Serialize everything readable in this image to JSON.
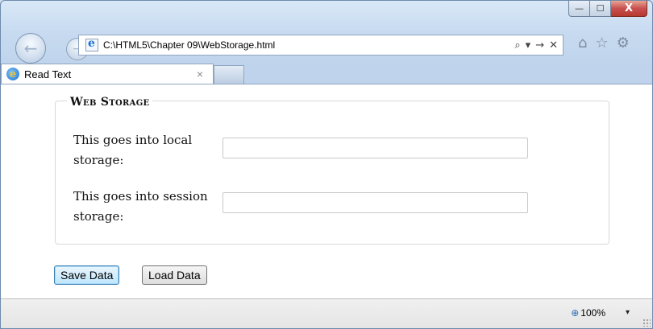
{
  "window": {
    "caption_buttons": {
      "minimize": "—",
      "maximize": "☐",
      "close": "X"
    }
  },
  "nav": {
    "back_glyph": "←",
    "forward_glyph": "→",
    "address": "C:\\HTML5\\Chapter 09\\WebStorage.html",
    "search_glyph": "⌕",
    "dropdown_glyph": "▾",
    "go_glyph": "→",
    "stop_glyph": "✕",
    "right_icons": {
      "home": "⌂",
      "favorites": "☆",
      "tools": "⚙"
    }
  },
  "tab": {
    "icon_letter": "e",
    "label": "Read Text",
    "close_glyph": "×"
  },
  "page": {
    "legend": "Web Storage",
    "fields": [
      {
        "label": "This goes into local storage:",
        "value": "",
        "placeholder": ""
      },
      {
        "label": "This goes into session storage:",
        "value": "",
        "placeholder": ""
      }
    ],
    "buttons": {
      "save": "Save Data",
      "load": "Load Data"
    }
  },
  "status": {
    "zoom_icon": "⊕",
    "zoom": "100%",
    "zoom_dropdown": "▾"
  }
}
